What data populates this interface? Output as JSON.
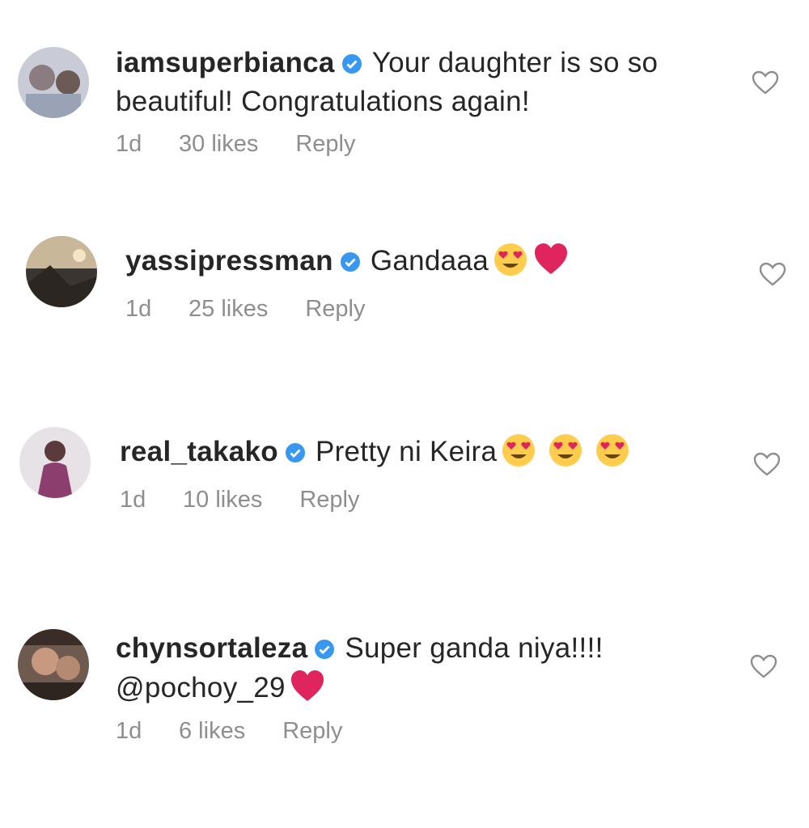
{
  "comments": [
    {
      "username": "iamsuperbianca",
      "verified": true,
      "text": "Your daughter is so so beautiful! Congratulations again!",
      "emojis": [],
      "time": "1d",
      "likes": "30 likes",
      "reply": "Reply"
    },
    {
      "username": "yassipressman",
      "verified": true,
      "text": "Gandaaa",
      "emojis": [
        "heart-eyes-emoji",
        "red-heart-emoji"
      ],
      "time": "1d",
      "likes": "25 likes",
      "reply": "Reply"
    },
    {
      "username": "real_takako",
      "verified": true,
      "text": "Pretty ni Keira",
      "emojis": [
        "heart-eyes-emoji",
        "heart-eyes-emoji",
        "heart-eyes-emoji"
      ],
      "time": "1d",
      "likes": "10 likes",
      "reply": "Reply"
    },
    {
      "username": "chynsortaleza",
      "verified": true,
      "text": "Super ganda niya!!!! @pochoy_29",
      "emojis": [
        "red-heart-emoji"
      ],
      "time": "1d",
      "likes": "6 likes",
      "reply": "Reply"
    }
  ],
  "colors": {
    "text": "#262626",
    "meta": "#8e8e8e",
    "verified_badge": "#3897f0",
    "heart_outline": "#8e8e8e",
    "red_heart": "#e0245e",
    "emoji_face": "#ffcc4d"
  },
  "icons": {
    "like": "heart-outline-icon",
    "verified": "verified-badge-icon"
  }
}
